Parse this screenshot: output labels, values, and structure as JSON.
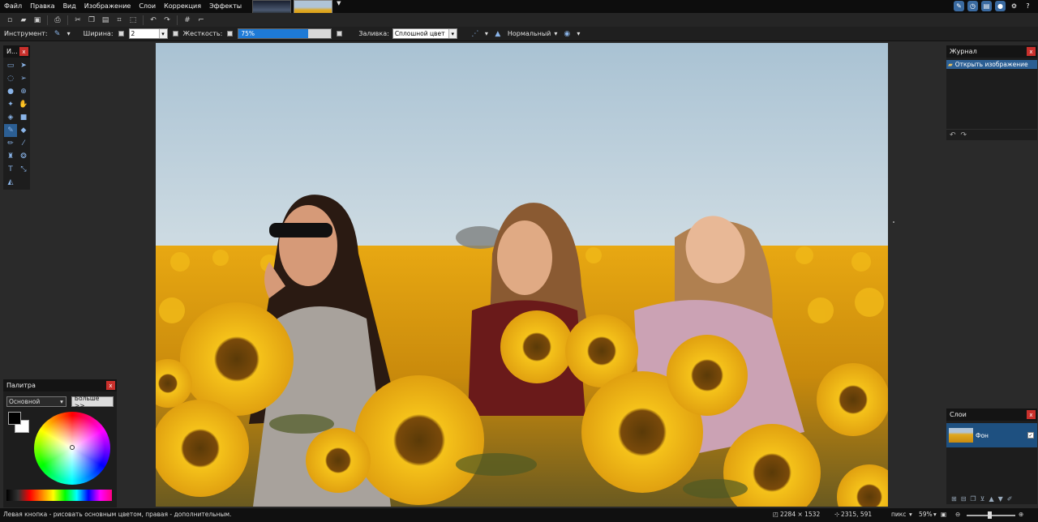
{
  "menu": [
    "Файл",
    "Правка",
    "Вид",
    "Изображение",
    "Слои",
    "Коррекция",
    "Эффекты"
  ],
  "toolbar2": {
    "tool_label": "Инструмент:",
    "width_label": "Ширина:",
    "width_value": "2",
    "hardness_label": "Жесткость:",
    "hardness_value": "75%",
    "hardness_fraction": 0.75,
    "fill_label": "Заливка:",
    "fill_value": "Сплошной цвет",
    "blend_value": "Нормальный"
  },
  "tools_panel": {
    "title": "И..."
  },
  "palette": {
    "title": "Палитра",
    "mode": "Основной",
    "more_button": "Больше >>"
  },
  "journal": {
    "title": "Журнал",
    "items": [
      "Открыть изображение"
    ]
  },
  "layers": {
    "title": "Слои",
    "items": [
      "Фон"
    ]
  },
  "status": {
    "hint": "Левая кнопка - рисовать основным цветом, правая - дополнительным.",
    "image_size": "2284 × 1532",
    "cursor_pos": "2315, 591",
    "unit": "пикс",
    "zoom": "59%"
  },
  "colors": {
    "accent": "#2c5f94",
    "primary": "#000000",
    "secondary": "#ffffff"
  }
}
